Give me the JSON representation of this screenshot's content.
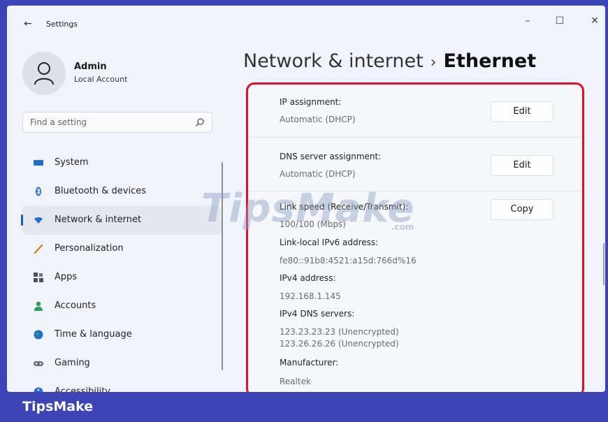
{
  "window": {
    "title": "Settings",
    "back_icon": "back-arrow-icon",
    "controls": [
      "minimize-icon",
      "maximize-icon",
      "close-icon"
    ]
  },
  "profile": {
    "name": "Admin",
    "account_type": "Local Account"
  },
  "search": {
    "placeholder": "Find a setting"
  },
  "sidebar": {
    "items": [
      {
        "label": "System",
        "icon": "display-icon",
        "active": false
      },
      {
        "label": "Bluetooth & devices",
        "icon": "bluetooth-icon",
        "active": false
      },
      {
        "label": "Network & internet",
        "icon": "wifi-icon",
        "active": true
      },
      {
        "label": "Personalization",
        "icon": "brush-icon",
        "active": false
      },
      {
        "label": "Apps",
        "icon": "apps-icon",
        "active": false
      },
      {
        "label": "Accounts",
        "icon": "person-icon",
        "active": false
      },
      {
        "label": "Time & language",
        "icon": "globe-icon",
        "active": false
      },
      {
        "label": "Gaming",
        "icon": "gamepad-icon",
        "active": false
      },
      {
        "label": "Accessibility",
        "icon": "accessibility-icon",
        "active": false
      }
    ]
  },
  "breadcrumb": {
    "parent": "Network & internet",
    "separator": "›",
    "current": "Ethernet"
  },
  "details": {
    "ip_assignment": {
      "label": "IP assignment:",
      "value": "Automatic (DHCP)",
      "button": "Edit"
    },
    "dns_assignment": {
      "label": "DNS server assignment:",
      "value": "Automatic (DHCP)",
      "button": "Edit"
    },
    "link_speed": {
      "label": "Link speed (Receive/Transmit):",
      "value": "100/100 (Mbps)",
      "button": "Copy"
    },
    "ipv6": {
      "label": "Link-local IPv6 address:",
      "value": "fe80::91b8:4521:a15d:766d%16"
    },
    "ipv4": {
      "label": "IPv4 address:",
      "value": "192.168.1.145"
    },
    "ipv4_dns": {
      "label": "IPv4 DNS servers:",
      "value_1": "123.23.23.23 (Unencrypted)",
      "value_2": "123.26.26.26 (Unencrypted)"
    },
    "manufacturer": {
      "label": "Manufacturer:",
      "value": "Realtek"
    }
  },
  "watermark": {
    "text": "TipsMake",
    "suffix": ".com"
  },
  "footer": {
    "brand": "TipsMake"
  },
  "colors": {
    "highlight_border": "#e0102a",
    "footer_bg": "#3d45b6",
    "accent": "#1a5fb4"
  }
}
